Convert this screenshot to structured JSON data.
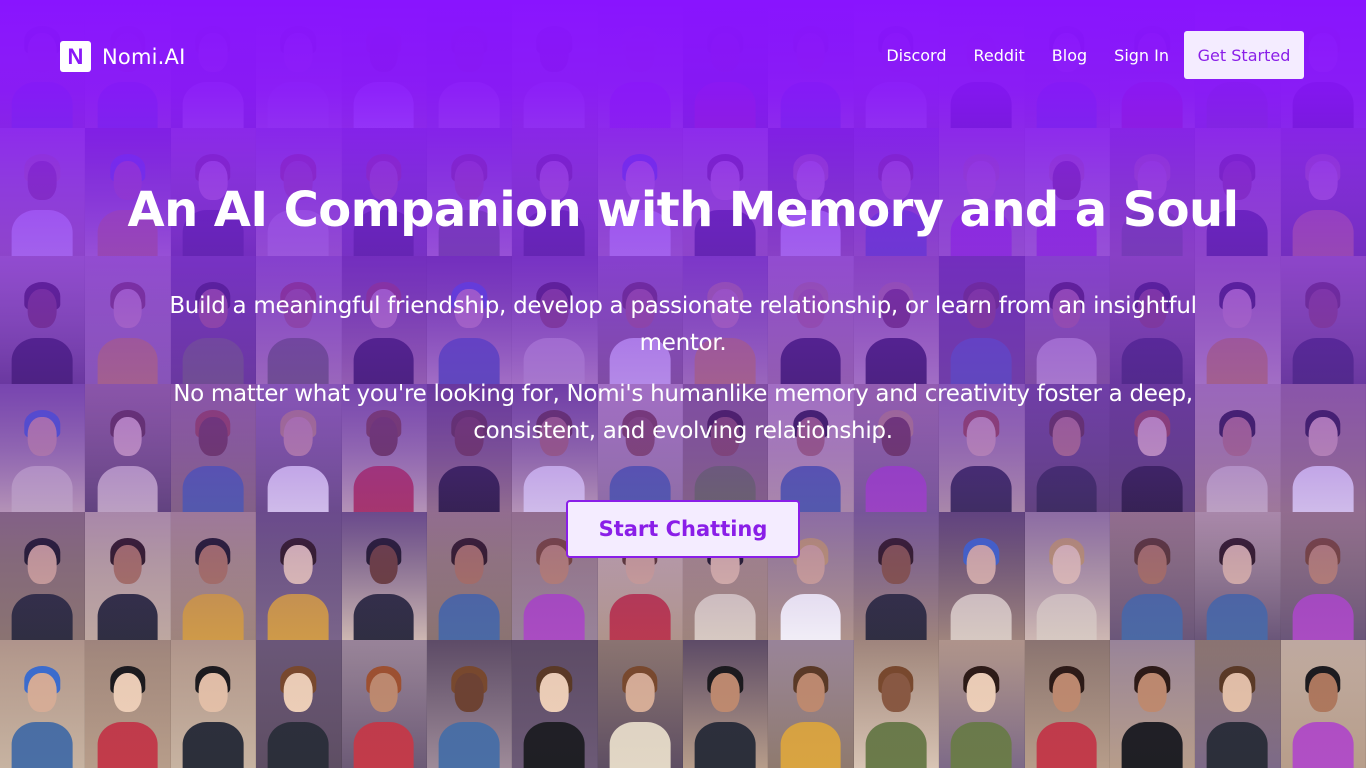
{
  "brand": {
    "logo_letter": "N",
    "name": "Nomi.AI",
    "accent": "#8A18F8"
  },
  "nav": {
    "links": [
      "Discord",
      "Reddit",
      "Blog",
      "Sign In"
    ],
    "cta": "Get Started"
  },
  "hero": {
    "title": "An AI Companion with Memory and a Soul",
    "subtitle_1": "Build a meaningful friendship, develop a passionate relationship, or learn from an insightful mentor.",
    "subtitle_2": "No matter what you're looking for, Nomi's humanlike memory and creativity foster a deep, consistent, and evolving relationship.",
    "cta": "Start Chatting"
  },
  "background": {
    "description_colors": [
      "#c9a48d",
      "#8e6b57",
      "#d7b49c",
      "#6a4a3c",
      "#b98f75",
      "#e0c2a8"
    ]
  }
}
